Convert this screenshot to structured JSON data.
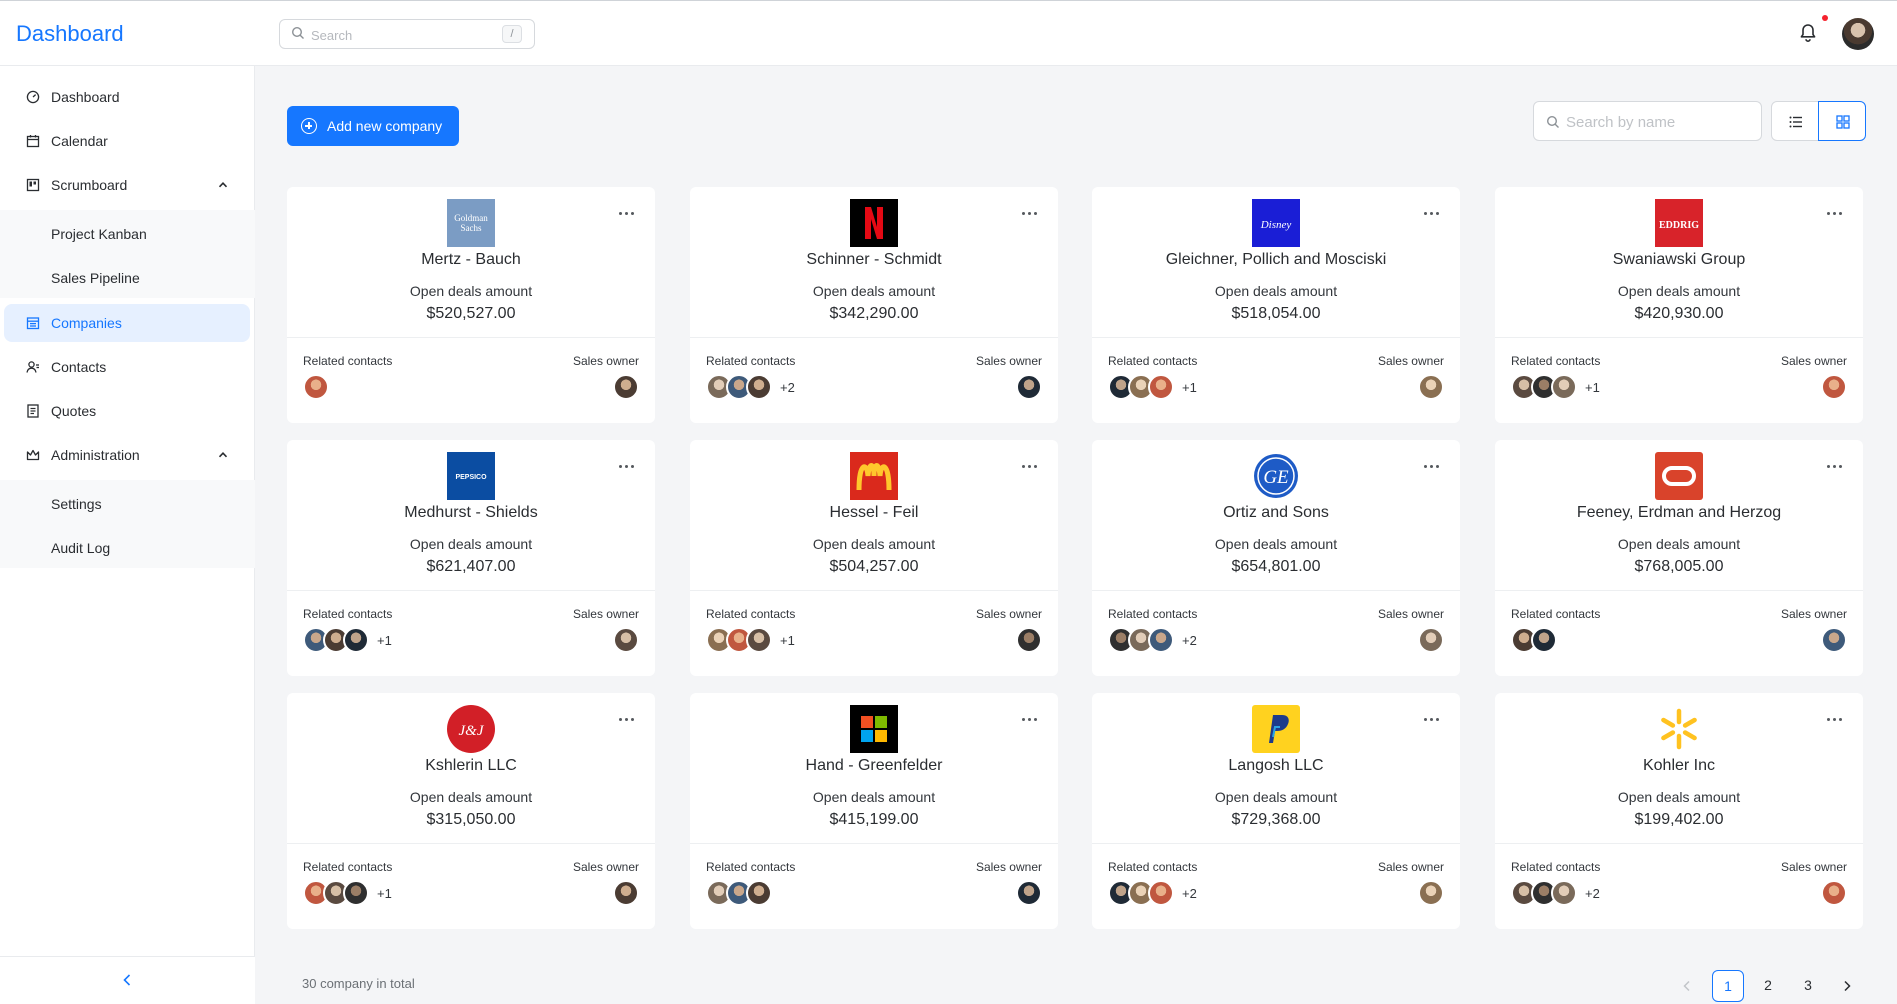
{
  "header": {
    "app_title": "Dashboard",
    "search_placeholder": "Search",
    "search_shortcut": "/"
  },
  "sidebar": {
    "items": [
      {
        "label": "Dashboard",
        "icon": "dashboard-icon"
      },
      {
        "label": "Calendar",
        "icon": "calendar-icon"
      },
      {
        "label": "Scrumboard",
        "icon": "scrumboard-icon",
        "expanded": true
      },
      {
        "label": "Project Kanban"
      },
      {
        "label": "Sales Pipeline"
      },
      {
        "label": "Companies",
        "icon": "shop-icon",
        "active": true
      },
      {
        "label": "Contacts",
        "icon": "contacts-icon"
      },
      {
        "label": "Quotes",
        "icon": "quotes-icon"
      },
      {
        "label": "Administration",
        "icon": "crown-icon",
        "expanded": true
      },
      {
        "label": "Settings"
      },
      {
        "label": "Audit Log"
      }
    ]
  },
  "toolbar": {
    "add_label": "Add new company",
    "search_placeholder": "Search by name",
    "view_mode": "grid"
  },
  "card_labels": {
    "deal_label": "Open deals amount",
    "related_contacts": "Related contacts",
    "sales_owner": "Sales owner"
  },
  "companies": [
    {
      "name": "Mertz - Bauch",
      "amount": "$520,527.00",
      "logo": "goldman-sachs-logo",
      "logo_text": "Goldman Sachs",
      "extra": ""
    },
    {
      "name": "Schinner - Schmidt",
      "amount": "$342,290.00",
      "logo": "netflix-logo",
      "extra": "+2"
    },
    {
      "name": "Gleichner, Pollich and Mosciski",
      "amount": "$518,054.00",
      "logo": "disney-logo",
      "logo_text": "Disney",
      "extra": "+1"
    },
    {
      "name": "Swaniawski Group",
      "amount": "$420,930.00",
      "logo": "eddrig-logo",
      "logo_text": "EDDRIG",
      "extra": "+1"
    },
    {
      "name": "Medhurst - Shields",
      "amount": "$621,407.00",
      "logo": "pepsico-logo",
      "logo_text": "PEPSICO",
      "extra": "+1"
    },
    {
      "name": "Hessel - Feil",
      "amount": "$504,257.00",
      "logo": "mcdonalds-logo",
      "extra": "+1"
    },
    {
      "name": "Ortiz and Sons",
      "amount": "$654,801.00",
      "logo": "ge-logo",
      "extra": "+2"
    },
    {
      "name": "Feeney, Erdman and Herzog",
      "amount": "$768,005.00",
      "logo": "oracle-logo",
      "extra": ""
    },
    {
      "name": "Kshlerin LLC",
      "amount": "$315,050.00",
      "logo": "johnson-logo",
      "extra": "+1"
    },
    {
      "name": "Hand - Greenfelder",
      "amount": "$415,199.00",
      "logo": "microsoft-logo",
      "extra": ""
    },
    {
      "name": "Langosh LLC",
      "amount": "$729,368.00",
      "logo": "paypal-logo",
      "extra": "+2"
    },
    {
      "name": "Kohler Inc",
      "amount": "$199,402.00",
      "logo": "walmart-logo",
      "extra": "+2"
    }
  ],
  "footer": {
    "total": "30 company in total",
    "pages": [
      "1",
      "2",
      "3"
    ],
    "current_page": "1"
  },
  "colors": {
    "accent": "#1677ff",
    "background": "#f4f5f7",
    "card": "#ffffff"
  }
}
